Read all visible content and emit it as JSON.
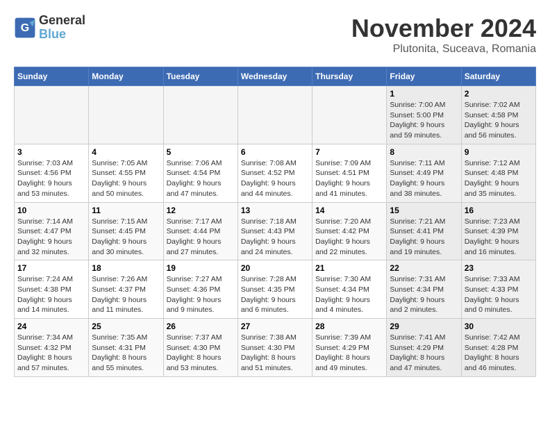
{
  "header": {
    "logo_line1": "General",
    "logo_line2": "Blue",
    "title": "November 2024",
    "subtitle": "Plutonita, Suceava, Romania"
  },
  "weekdays": [
    "Sunday",
    "Monday",
    "Tuesday",
    "Wednesday",
    "Thursday",
    "Friday",
    "Saturday"
  ],
  "weeks": [
    [
      {
        "day": "",
        "info": ""
      },
      {
        "day": "",
        "info": ""
      },
      {
        "day": "",
        "info": ""
      },
      {
        "day": "",
        "info": ""
      },
      {
        "day": "",
        "info": ""
      },
      {
        "day": "1",
        "info": "Sunrise: 7:00 AM\nSunset: 5:00 PM\nDaylight: 9 hours\nand 59 minutes."
      },
      {
        "day": "2",
        "info": "Sunrise: 7:02 AM\nSunset: 4:58 PM\nDaylight: 9 hours\nand 56 minutes."
      }
    ],
    [
      {
        "day": "3",
        "info": "Sunrise: 7:03 AM\nSunset: 4:56 PM\nDaylight: 9 hours\nand 53 minutes."
      },
      {
        "day": "4",
        "info": "Sunrise: 7:05 AM\nSunset: 4:55 PM\nDaylight: 9 hours\nand 50 minutes."
      },
      {
        "day": "5",
        "info": "Sunrise: 7:06 AM\nSunset: 4:54 PM\nDaylight: 9 hours\nand 47 minutes."
      },
      {
        "day": "6",
        "info": "Sunrise: 7:08 AM\nSunset: 4:52 PM\nDaylight: 9 hours\nand 44 minutes."
      },
      {
        "day": "7",
        "info": "Sunrise: 7:09 AM\nSunset: 4:51 PM\nDaylight: 9 hours\nand 41 minutes."
      },
      {
        "day": "8",
        "info": "Sunrise: 7:11 AM\nSunset: 4:49 PM\nDaylight: 9 hours\nand 38 minutes."
      },
      {
        "day": "9",
        "info": "Sunrise: 7:12 AM\nSunset: 4:48 PM\nDaylight: 9 hours\nand 35 minutes."
      }
    ],
    [
      {
        "day": "10",
        "info": "Sunrise: 7:14 AM\nSunset: 4:47 PM\nDaylight: 9 hours\nand 32 minutes."
      },
      {
        "day": "11",
        "info": "Sunrise: 7:15 AM\nSunset: 4:45 PM\nDaylight: 9 hours\nand 30 minutes."
      },
      {
        "day": "12",
        "info": "Sunrise: 7:17 AM\nSunset: 4:44 PM\nDaylight: 9 hours\nand 27 minutes."
      },
      {
        "day": "13",
        "info": "Sunrise: 7:18 AM\nSunset: 4:43 PM\nDaylight: 9 hours\nand 24 minutes."
      },
      {
        "day": "14",
        "info": "Sunrise: 7:20 AM\nSunset: 4:42 PM\nDaylight: 9 hours\nand 22 minutes."
      },
      {
        "day": "15",
        "info": "Sunrise: 7:21 AM\nSunset: 4:41 PM\nDaylight: 9 hours\nand 19 minutes."
      },
      {
        "day": "16",
        "info": "Sunrise: 7:23 AM\nSunset: 4:39 PM\nDaylight: 9 hours\nand 16 minutes."
      }
    ],
    [
      {
        "day": "17",
        "info": "Sunrise: 7:24 AM\nSunset: 4:38 PM\nDaylight: 9 hours\nand 14 minutes."
      },
      {
        "day": "18",
        "info": "Sunrise: 7:26 AM\nSunset: 4:37 PM\nDaylight: 9 hours\nand 11 minutes."
      },
      {
        "day": "19",
        "info": "Sunrise: 7:27 AM\nSunset: 4:36 PM\nDaylight: 9 hours\nand 9 minutes."
      },
      {
        "day": "20",
        "info": "Sunrise: 7:28 AM\nSunset: 4:35 PM\nDaylight: 9 hours\nand 6 minutes."
      },
      {
        "day": "21",
        "info": "Sunrise: 7:30 AM\nSunset: 4:34 PM\nDaylight: 9 hours\nand 4 minutes."
      },
      {
        "day": "22",
        "info": "Sunrise: 7:31 AM\nSunset: 4:34 PM\nDaylight: 9 hours\nand 2 minutes."
      },
      {
        "day": "23",
        "info": "Sunrise: 7:33 AM\nSunset: 4:33 PM\nDaylight: 9 hours\nand 0 minutes."
      }
    ],
    [
      {
        "day": "24",
        "info": "Sunrise: 7:34 AM\nSunset: 4:32 PM\nDaylight: 8 hours\nand 57 minutes."
      },
      {
        "day": "25",
        "info": "Sunrise: 7:35 AM\nSunset: 4:31 PM\nDaylight: 8 hours\nand 55 minutes."
      },
      {
        "day": "26",
        "info": "Sunrise: 7:37 AM\nSunset: 4:30 PM\nDaylight: 8 hours\nand 53 minutes."
      },
      {
        "day": "27",
        "info": "Sunrise: 7:38 AM\nSunset: 4:30 PM\nDaylight: 8 hours\nand 51 minutes."
      },
      {
        "day": "28",
        "info": "Sunrise: 7:39 AM\nSunset: 4:29 PM\nDaylight: 8 hours\nand 49 minutes."
      },
      {
        "day": "29",
        "info": "Sunrise: 7:41 AM\nSunset: 4:29 PM\nDaylight: 8 hours\nand 47 minutes."
      },
      {
        "day": "30",
        "info": "Sunrise: 7:42 AM\nSunset: 4:28 PM\nDaylight: 8 hours\nand 46 minutes."
      }
    ]
  ]
}
